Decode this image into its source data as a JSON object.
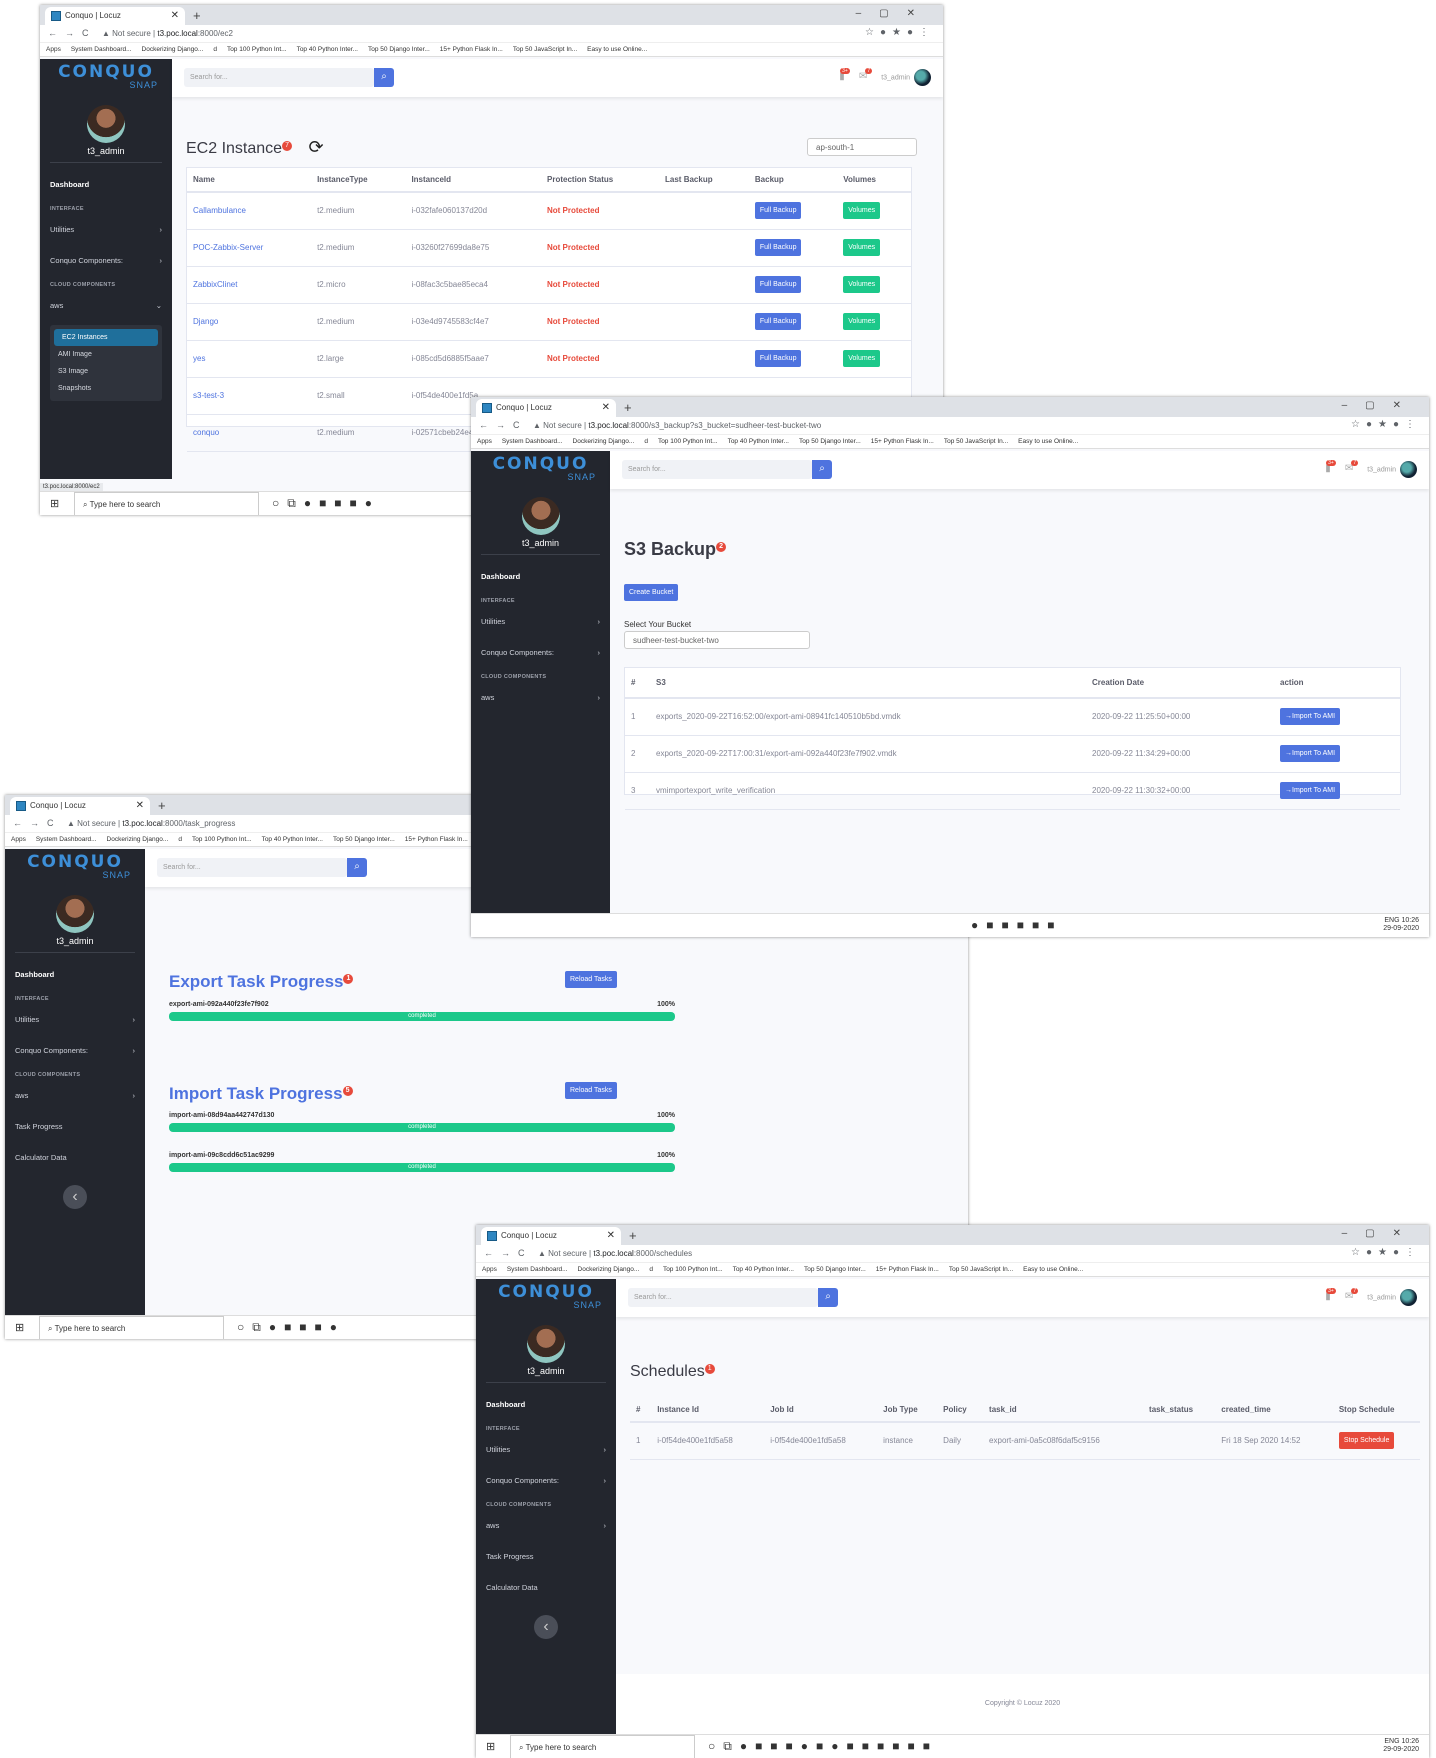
{
  "tab_title": "Conquo | Locuz",
  "bookmarks": [
    "Apps",
    "System Dashboard...",
    "Dockerizing Django...",
    "d",
    "Top 100 Python Int...",
    "Top 40 Python Inter...",
    "Top 50 Django Inter...",
    "15+ Python Flask In...",
    "Top 50 JavaScript In...",
    "Easy to use Online..."
  ],
  "security_label": "Not secure",
  "logo_main": "CONQUO",
  "logo_sub": "SNAP",
  "username": "t3_admin",
  "search_placeholder": "Search for...",
  "alerts_count": "3+",
  "messages_count": "7",
  "sidebar": {
    "dashboard": "Dashboard",
    "interface_head": "INTERFACE",
    "utilities": "Utilities",
    "conquo_components": "Conquo Components:",
    "cloud_head": "CLOUD COMPONENTS",
    "aws": "aws",
    "sub_items": [
      "EC2 Instances",
      "AMI Image",
      "S3 Image",
      "Snapshots"
    ],
    "task_progress": "Task Progress",
    "calculator": "Calculator Data"
  },
  "taskbar": {
    "search": "Type here to search",
    "time": "10:26",
    "date": "29-09-2020",
    "lang": "ENG"
  },
  "ec2": {
    "url_host": "t3.poc.local",
    "url_path": ":8000/ec2",
    "title": "EC2 Instance",
    "badge": "7",
    "region": "ap-south-1",
    "status_link": "t3.poc.local:8000/ec2",
    "headers": [
      "Name",
      "InstanceType",
      "InstanceId",
      "Protection Status",
      "Last Backup",
      "Backup",
      "Volumes"
    ],
    "full_backup": "Full Backup",
    "volumes": "Volumes",
    "rows": [
      {
        "name": "Callambulance",
        "type": "t2.medium",
        "id": "i-032fafe060137d20d",
        "status": "Not Protected"
      },
      {
        "name": "POC-Zabbix-Server",
        "type": "t2.medium",
        "id": "i-03260f27699da8e75",
        "status": "Not Protected"
      },
      {
        "name": "ZabbixClinet",
        "type": "t2.micro",
        "id": "i-08fac3c5bae85eca4",
        "status": "Not Protected"
      },
      {
        "name": "Django",
        "type": "t2.medium",
        "id": "i-03e4d9745583cf4e7",
        "status": "Not Protected"
      },
      {
        "name": "yes",
        "type": "t2.large",
        "id": "i-085cd5d6885f5aae7",
        "status": "Not Protected"
      },
      {
        "name": "s3-test-3",
        "type": "t2.small",
        "id": "i-0f54de400e1fd5a",
        "status": ""
      },
      {
        "name": "conquo",
        "type": "t2.medium",
        "id": "i-02571cbeb24e40",
        "status": ""
      }
    ]
  },
  "s3": {
    "url_host": "t3.poc.local",
    "url_path": ":8000/s3_backup?s3_bucket=sudheer-test-bucket-two",
    "title": "S3 Backup",
    "badge": "2",
    "create_bucket": "Create Bucket",
    "select_label": "Select Your Bucket",
    "bucket": "sudheer-test-bucket-two",
    "headers": [
      "#",
      "S3",
      "Creation Date",
      "action"
    ],
    "import_label": "Import To AMI",
    "rows": [
      {
        "n": "1",
        "key": "exports_2020-09-22T16:52:00/export-ami-08941fc140510b5bd.vmdk",
        "date": "2020-09-22 11:25:50+00:00"
      },
      {
        "n": "2",
        "key": "exports_2020-09-22T17:00:31/export-ami-092a440f23fe7f902.vmdk",
        "date": "2020-09-22 11:34:29+00:00"
      },
      {
        "n": "3",
        "key": "vmimportexport_write_verification",
        "date": "2020-09-22 11:30:32+00:00"
      }
    ]
  },
  "tasks": {
    "url_host": "t3.poc.local",
    "url_path": ":8000/task_progress",
    "export_title": "Export Task Progress",
    "export_badge": "1",
    "import_title": "Import Task Progress",
    "import_badge": "5",
    "reload": "Reload Tasks",
    "export_items": [
      {
        "name": "export-ami-092a440f23fe7f902",
        "pct": "100%",
        "status": "completed",
        "fraction": 1.0
      }
    ],
    "import_items": [
      {
        "name": "import-ami-08d94aa442747d130",
        "pct": "100%",
        "status": "completed",
        "fraction": 1.0
      },
      {
        "name": "import-ami-09c8cdd6c51ac9299",
        "pct": "100%",
        "status": "completed",
        "fraction": 1.0
      }
    ]
  },
  "schedules": {
    "url_host": "t3.poc.local",
    "url_path": ":8000/schedules",
    "title": "Schedules",
    "badge": "1",
    "headers": [
      "#",
      "Instance Id",
      "Job Id",
      "Job Type",
      "Policy",
      "task_id",
      "task_status",
      "created_time",
      "Stop Schedule"
    ],
    "row": {
      "n": "1",
      "instance": "i-0f54de400e1fd5a58",
      "job": "i-0f54de400e1fd5a58",
      "type": "instance",
      "policy": "Daily",
      "task": "export-ami-0a5c08f6daf5c9156",
      "task_status": "",
      "created": "Fri 18 Sep 2020 14:52"
    },
    "stop": "Stop Schedule",
    "footer": "Copyright © Locuz 2020"
  }
}
